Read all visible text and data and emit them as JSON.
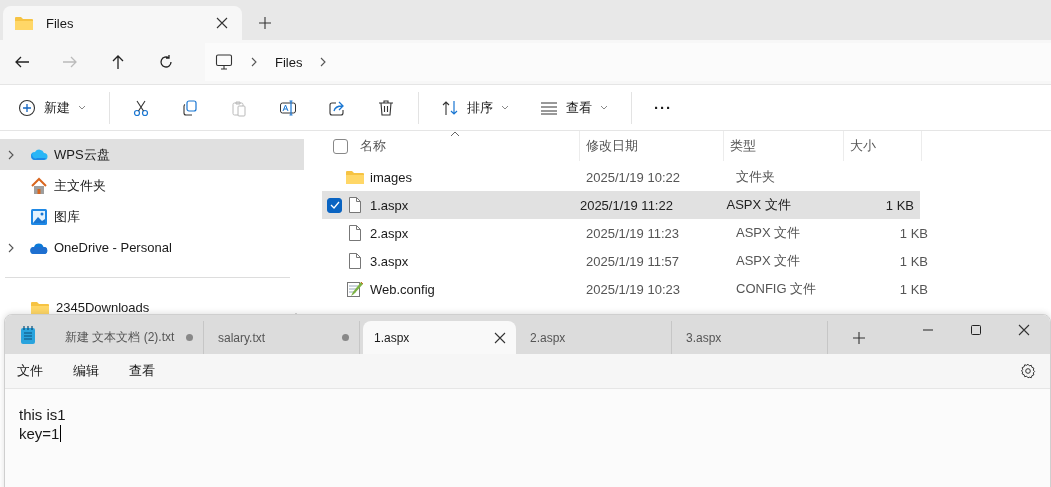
{
  "explorer": {
    "tabs": [
      {
        "label": "Files",
        "selected": true
      }
    ],
    "nav_buttons": [
      {
        "kind": "back",
        "disabled": false
      },
      {
        "kind": "forward",
        "disabled": true
      },
      {
        "kind": "up",
        "disabled": false
      },
      {
        "kind": "refresh",
        "disabled": false
      }
    ],
    "breadcrumb": [
      "Files"
    ],
    "commands": [
      {
        "kind": "new",
        "label": "新建",
        "disabled": false
      },
      {
        "kind": "sep"
      },
      {
        "kind": "cut",
        "disabled": false
      },
      {
        "kind": "copy",
        "disabled": false
      },
      {
        "kind": "paste",
        "disabled": true
      },
      {
        "kind": "rename",
        "disabled": false
      },
      {
        "kind": "share",
        "disabled": false
      },
      {
        "kind": "delete",
        "disabled": false
      },
      {
        "kind": "sep"
      },
      {
        "kind": "sort",
        "label": "排序",
        "disabled": false
      },
      {
        "kind": "view",
        "label": "查看",
        "disabled": false
      },
      {
        "kind": "sep"
      },
      {
        "kind": "more",
        "label": "···",
        "disabled": false
      }
    ],
    "sidebar": {
      "items": [
        {
          "label": "WPS云盘",
          "kind": "cloud-wps",
          "expandable": true,
          "selected": true
        },
        {
          "label": "主文件夹",
          "kind": "home",
          "expandable": false,
          "selected": false
        },
        {
          "label": "图库",
          "kind": "gallery",
          "expandable": false,
          "selected": false
        },
        {
          "label": "OneDrive - Personal",
          "kind": "cloud",
          "expandable": true,
          "selected": false
        },
        {
          "kind": "divider"
        },
        {
          "label": "2345Downloads",
          "kind": "folder",
          "expandable": false,
          "selected": false,
          "pinned": true
        }
      ]
    },
    "table": {
      "all_selected": false,
      "columns": [
        "名称",
        "修改日期",
        "类型",
        "大小"
      ],
      "rows": [
        {
          "name": "images",
          "kind": "folder",
          "modified": "2025/1/19 10:22",
          "type": "文件夹",
          "selected": false
        },
        {
          "name": "1.aspx",
          "kind": "file",
          "modified": "2025/1/19 11:22",
          "type": "ASPX 文件",
          "size": "1 KB",
          "selected": true
        },
        {
          "name": "2.aspx",
          "kind": "file",
          "modified": "2025/1/19 11:23",
          "type": "ASPX 文件",
          "size": "1 KB",
          "selected": false
        },
        {
          "name": "3.aspx",
          "kind": "file",
          "modified": "2025/1/19 11:57",
          "type": "ASPX 文件",
          "size": "1 KB",
          "selected": false
        },
        {
          "name": "Web.config",
          "kind": "config",
          "modified": "2025/1/19 10:23",
          "type": "CONFIG 文件",
          "size": "1 KB",
          "selected": false
        }
      ]
    }
  },
  "notepad": {
    "tabs": [
      {
        "label": "新建 文本文档 (2).txt",
        "modified": true,
        "selected": false
      },
      {
        "label": "salary.txt",
        "modified": true,
        "selected": false
      },
      {
        "label": "1.aspx",
        "modified": false,
        "selected": true
      },
      {
        "label": "2.aspx",
        "modified": false,
        "selected": false
      },
      {
        "label": "3.aspx",
        "modified": false,
        "selected": false
      }
    ],
    "menu": [
      "文件",
      "编辑",
      "查看"
    ],
    "lines": [
      "this is1",
      "key=1"
    ]
  }
}
